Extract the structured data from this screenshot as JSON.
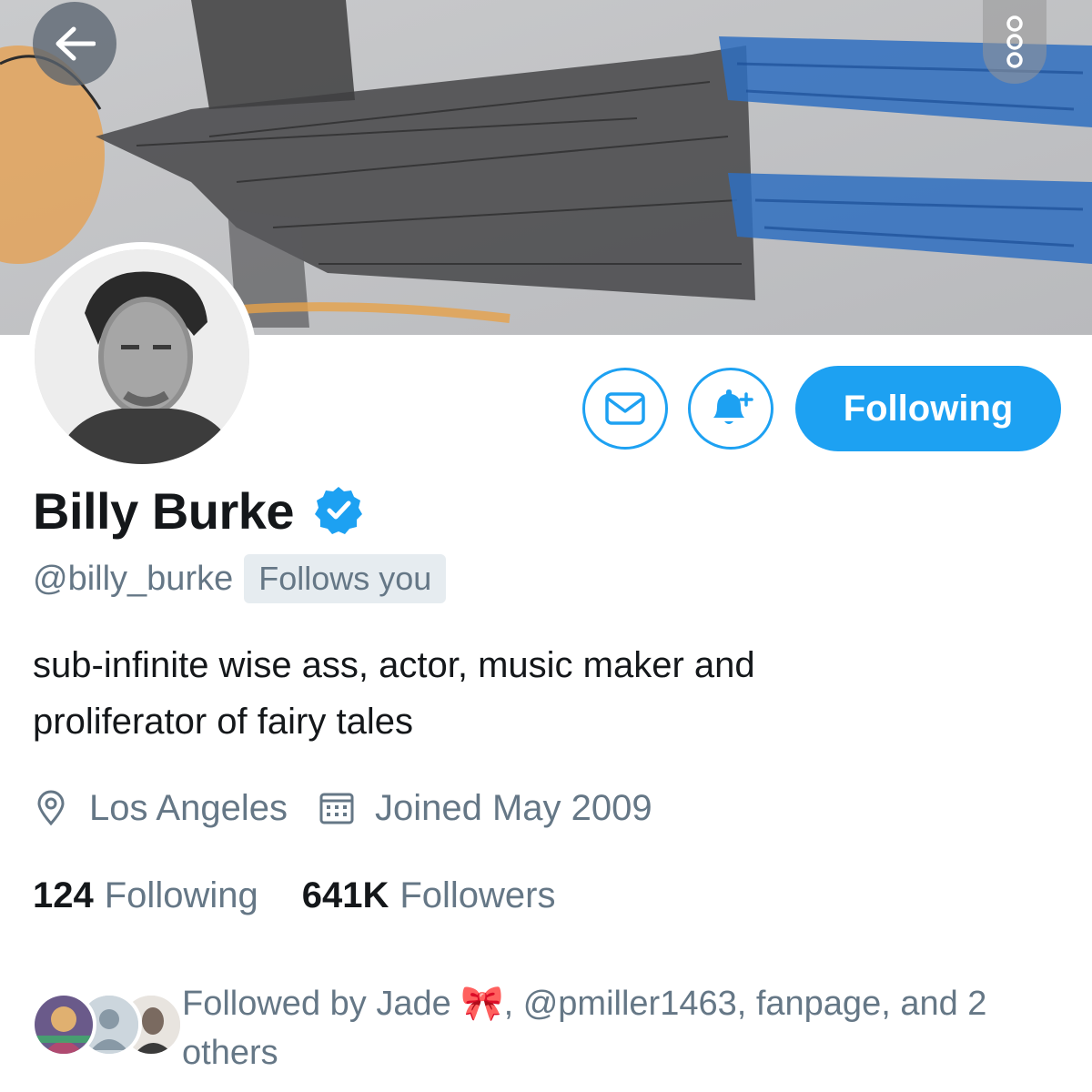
{
  "header": {
    "back_icon": "arrow-left-icon",
    "more_icon": "more-vertical-icon",
    "banner_description_colors": {
      "paper": "#c3c4c6",
      "pencil": "#3b3b3d",
      "blue": "#2b6fc0",
      "orange": "#e6a14a"
    }
  },
  "actions": {
    "message_icon": "envelope-icon",
    "notify_icon": "bell-plus-icon",
    "following_label": "Following"
  },
  "profile": {
    "name": "Billy Burke",
    "verified_icon": "verified-badge-icon",
    "handle": "@billy_burke",
    "follows_you": "Follows you",
    "bio_line_1": "sub-infinite wise ass, actor, music maker and",
    "bio_line_2": "proliferator of fairy tales",
    "location": "Los Angeles",
    "location_icon": "location-pin-icon",
    "joined": "Joined May 2009",
    "joined_icon": "calendar-icon"
  },
  "stats": {
    "following_count": "124",
    "following_label": "Following",
    "followers_count": "641K",
    "followers_label": "Followers"
  },
  "followed_by": {
    "text_line_1": "Followed by Jade 🎀, @pmiller1463, fanpage, and 2",
    "text_line_2": "others"
  },
  "colors": {
    "accent": "#1da1f2",
    "secondary_text": "#657786",
    "primary_text": "#14171a",
    "badge_bg": "#e6ecf0"
  }
}
